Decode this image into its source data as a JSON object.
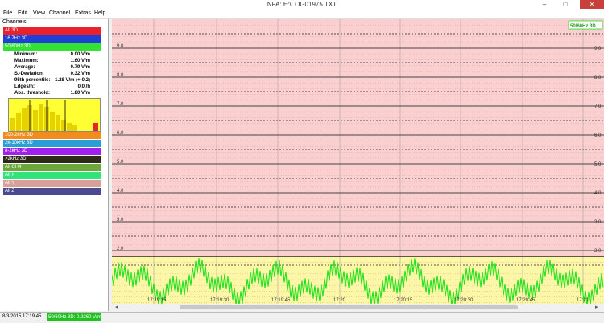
{
  "window": {
    "title": "NFA: E:\\LOG01975.TXT",
    "minimize": "–",
    "maximize": "□",
    "close": "✕"
  },
  "menu": [
    "File",
    "Edit",
    "View",
    "Channel",
    "Extras",
    "Help"
  ],
  "side": {
    "heading": "Channels",
    "channels_top": [
      {
        "label": "All 3D",
        "color": "#e8212b"
      },
      {
        "label": "16.7Hz 3D",
        "color": "#1f3fd6"
      },
      {
        "label": "50/60Hz 3D",
        "color": "#33e233"
      }
    ],
    "stats": [
      {
        "k": "Minimum:",
        "v": "0.00 V/m"
      },
      {
        "k": "Maximum:",
        "v": "1.60 V/m"
      },
      {
        "k": "Average:",
        "v": "0.79 V/m"
      },
      {
        "k": "S.-Deviation:",
        "v": "0.32 V/m"
      },
      {
        "k": "95th percentile:",
        "v": "1.28 V/m (+-0.2)"
      },
      {
        "k": "Ldges/h:",
        "v": "0.0 /h"
      },
      {
        "k": "Abs. threshold:",
        "v": "1.80 V/m"
      }
    ],
    "channels_bottom": [
      {
        "label": "100-2kHz 3D",
        "color": "#f28c1e"
      },
      {
        "label": "2k-10kHz 3D",
        "color": "#2a9fd6"
      },
      {
        "label": "8-2kHz 3D",
        "color": "#a020f0"
      },
      {
        "label": ">2kHz 3D",
        "color": "#2b2b18"
      },
      {
        "label": "All CH4",
        "color": "#6aa83b"
      },
      {
        "label": "All X",
        "color": "#33e27a"
      },
      {
        "label": "All Y",
        "color": "#d9a09a"
      },
      {
        "label": "All Z",
        "color": "#4a4a8e"
      }
    ]
  },
  "chart_data": {
    "type": "line",
    "legend": "50/60Hz 3D",
    "y_ticks": [
      "9.0",
      "8.0",
      "7.0",
      "6.0",
      "5.0",
      "4.0",
      "3.0",
      "2.0"
    ],
    "x_ticks": [
      "17:19:15",
      "17:19:30",
      "17:19:45",
      "17:20",
      "17:20:15",
      "17:20:30",
      "17:20:45",
      "17:21"
    ],
    "ylim": [
      0,
      10
    ],
    "threshold": 1.8,
    "series_color": "#22e21f",
    "colors": {
      "red_zone": "#f9d0cf",
      "yellow_zone": "#fbf7a7"
    }
  },
  "status": {
    "datetime": "8/3/2015 17:19:45",
    "readout": "50/60Hz 3D: 0.9260 V/m"
  }
}
